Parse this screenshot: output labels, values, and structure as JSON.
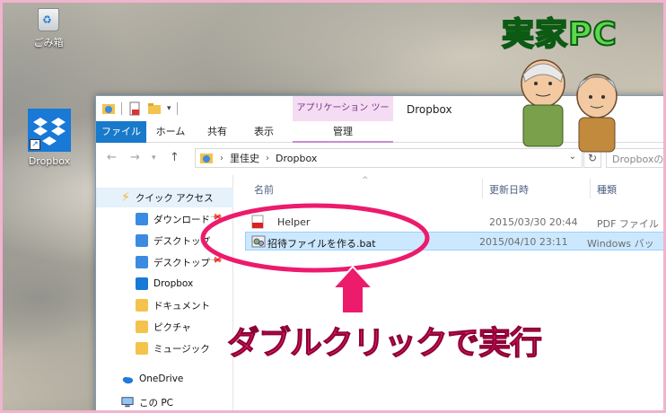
{
  "desktop": {
    "recycle_bin_label": "ごみ箱",
    "dropbox_label": "Dropbox"
  },
  "window": {
    "contextual_tab": "アプリケーション ツール",
    "title": "Dropbox",
    "ribbon_tabs": {
      "file": "ファイル",
      "home": "ホーム",
      "share": "共有",
      "view": "表示",
      "manage": "管理"
    },
    "breadcrumb": {
      "root": "里佳史",
      "folder": "Dropbox"
    },
    "search_placeholder": "Dropboxの"
  },
  "nav_pane": {
    "quick_access": "クイック アクセス",
    "items": [
      {
        "label": "ダウンロード",
        "icon": "download-folder-icon",
        "pinned": true
      },
      {
        "label": "デスクトップ",
        "icon": "desktop-folder-icon",
        "pinned": false
      },
      {
        "label": "デスクトップ",
        "icon": "desktop-folder-icon",
        "pinned": true
      },
      {
        "label": "Dropbox",
        "icon": "dropbox-icon",
        "pinned": false
      },
      {
        "label": "ドキュメント",
        "icon": "documents-folder-icon",
        "pinned": false
      },
      {
        "label": "ピクチャ",
        "icon": "pictures-folder-icon",
        "pinned": false
      },
      {
        "label": "ミュージック",
        "icon": "music-folder-icon",
        "pinned": false
      }
    ],
    "onedrive": "OneDrive",
    "this_pc": "この PC"
  },
  "file_list": {
    "columns": {
      "name": "名前",
      "modified": "更新日時",
      "type": "種類"
    },
    "rows": [
      {
        "name": "Helper",
        "modified": "2015/03/30 20:44",
        "type": "PDF ファイル",
        "icon": "pdf-icon"
      },
      {
        "name": "招待ファイルを作る.bat",
        "modified": "2015/04/10 23:11",
        "type": "Windows バッ",
        "icon": "batch-file-icon"
      }
    ]
  },
  "annotations": {
    "headline": "実家PC",
    "callout": "ダブルクリックで実行",
    "accent_pink": "#ec1b6c",
    "accent_green": "#5bd84a"
  }
}
